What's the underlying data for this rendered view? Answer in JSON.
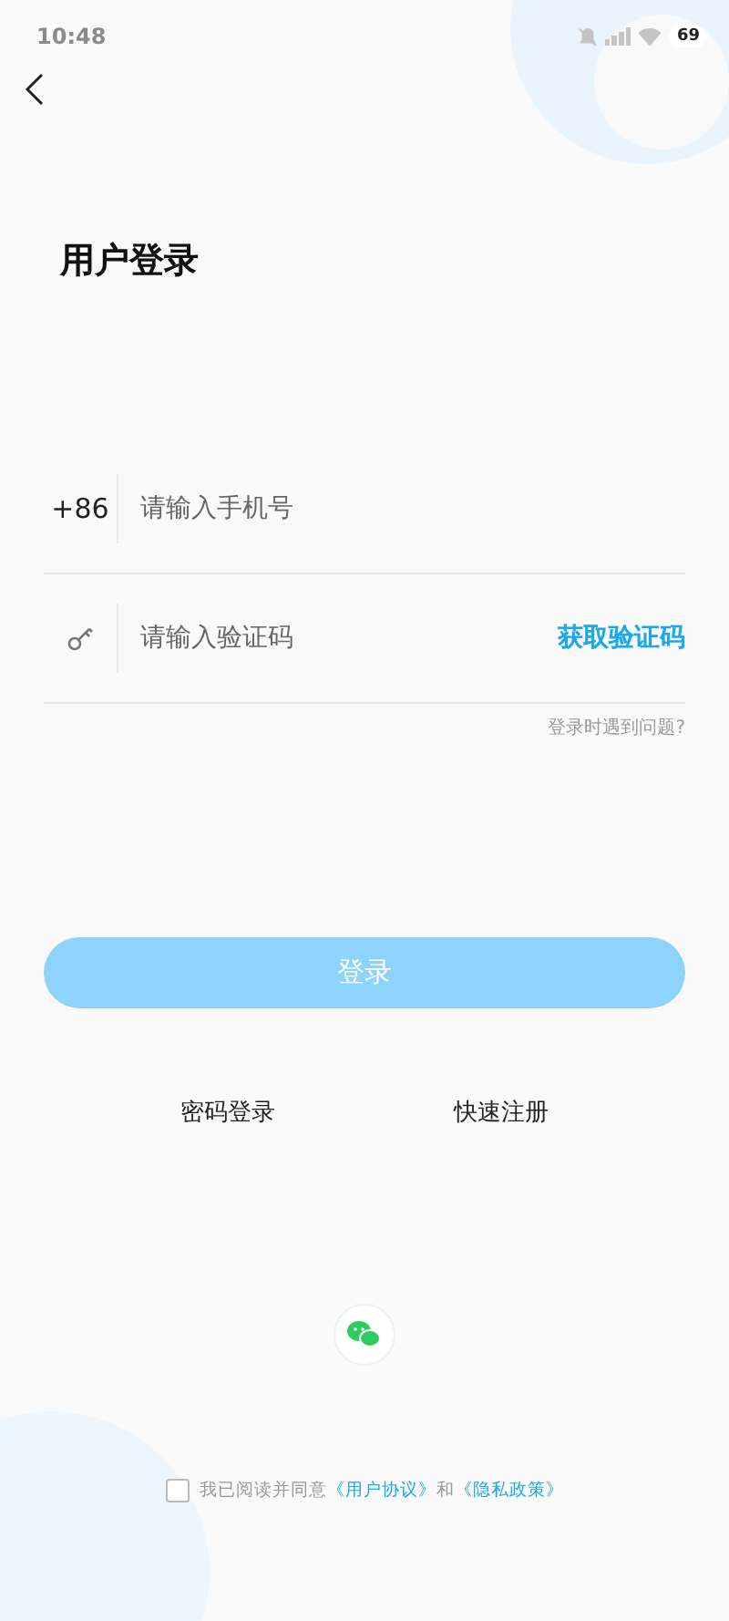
{
  "status_bar": {
    "time": "10:48",
    "battery": "69"
  },
  "title": "用户登录",
  "phone_field": {
    "prefix": "+86",
    "placeholder": "请输入手机号"
  },
  "code_field": {
    "placeholder": "请输入验证码",
    "action": "获取验证码"
  },
  "help_link": "登录时遇到问题?",
  "login_button": {
    "label": "登录",
    "disabled": true
  },
  "links": [
    "密码登录",
    "快速注册"
  ],
  "agreement": {
    "checked": false,
    "text": "我已阅读并同意",
    "links": [
      "《用户协议》",
      "《隐私政策》"
    ],
    "joiner": "和"
  }
}
